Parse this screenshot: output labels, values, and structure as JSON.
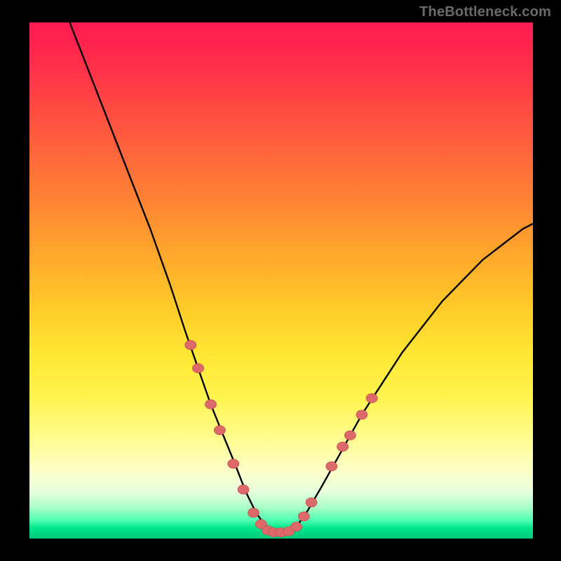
{
  "watermark": {
    "text": "TheBottleneck.com"
  },
  "colors": {
    "curve": "#000000",
    "marker_fill": "#dd6a6a",
    "marker_stroke": "#c94e4e",
    "gradient_top": "#ff1a52",
    "gradient_bottom": "#00c97c"
  },
  "chart_data": {
    "type": "line",
    "title": "",
    "xlabel": "",
    "ylabel": "",
    "xlim": [
      0,
      100
    ],
    "ylim": [
      0,
      100
    ],
    "series": [
      {
        "name": "bottleneck-curve",
        "x": [
          8,
          12,
          16,
          20,
          24,
          28,
          31,
          33.5,
          36,
          38.5,
          41,
          43,
          45,
          47,
          49,
          51,
          53,
          55,
          58,
          62,
          66,
          70,
          74,
          78,
          82,
          86,
          90,
          94,
          98,
          100
        ],
        "values": [
          100,
          90,
          80,
          70,
          60,
          49,
          40,
          33,
          26,
          20,
          14,
          9,
          5,
          2.3,
          1.2,
          1.2,
          2.3,
          5,
          10,
          17,
          24,
          30,
          36,
          41,
          46,
          50,
          54,
          57,
          60,
          61
        ]
      }
    ],
    "markers": [
      {
        "x": 32.0,
        "y": 37.5
      },
      {
        "x": 33.5,
        "y": 33.0
      },
      {
        "x": 36.0,
        "y": 26.0
      },
      {
        "x": 37.8,
        "y": 21.0
      },
      {
        "x": 40.5,
        "y": 14.5
      },
      {
        "x": 42.5,
        "y": 9.5
      },
      {
        "x": 44.5,
        "y": 5.0
      },
      {
        "x": 46.0,
        "y": 2.8
      },
      {
        "x": 47.3,
        "y": 1.6
      },
      {
        "x": 48.5,
        "y": 1.2
      },
      {
        "x": 50.0,
        "y": 1.2
      },
      {
        "x": 51.5,
        "y": 1.4
      },
      {
        "x": 53.0,
        "y": 2.3
      },
      {
        "x": 54.5,
        "y": 4.3
      },
      {
        "x": 56.0,
        "y": 7.0
      },
      {
        "x": 60.0,
        "y": 14.0
      },
      {
        "x": 62.2,
        "y": 17.8
      },
      {
        "x": 63.7,
        "y": 20.0
      },
      {
        "x": 66.0,
        "y": 24.0
      },
      {
        "x": 68.0,
        "y": 27.2
      }
    ],
    "marker_radius_px": 8
  }
}
